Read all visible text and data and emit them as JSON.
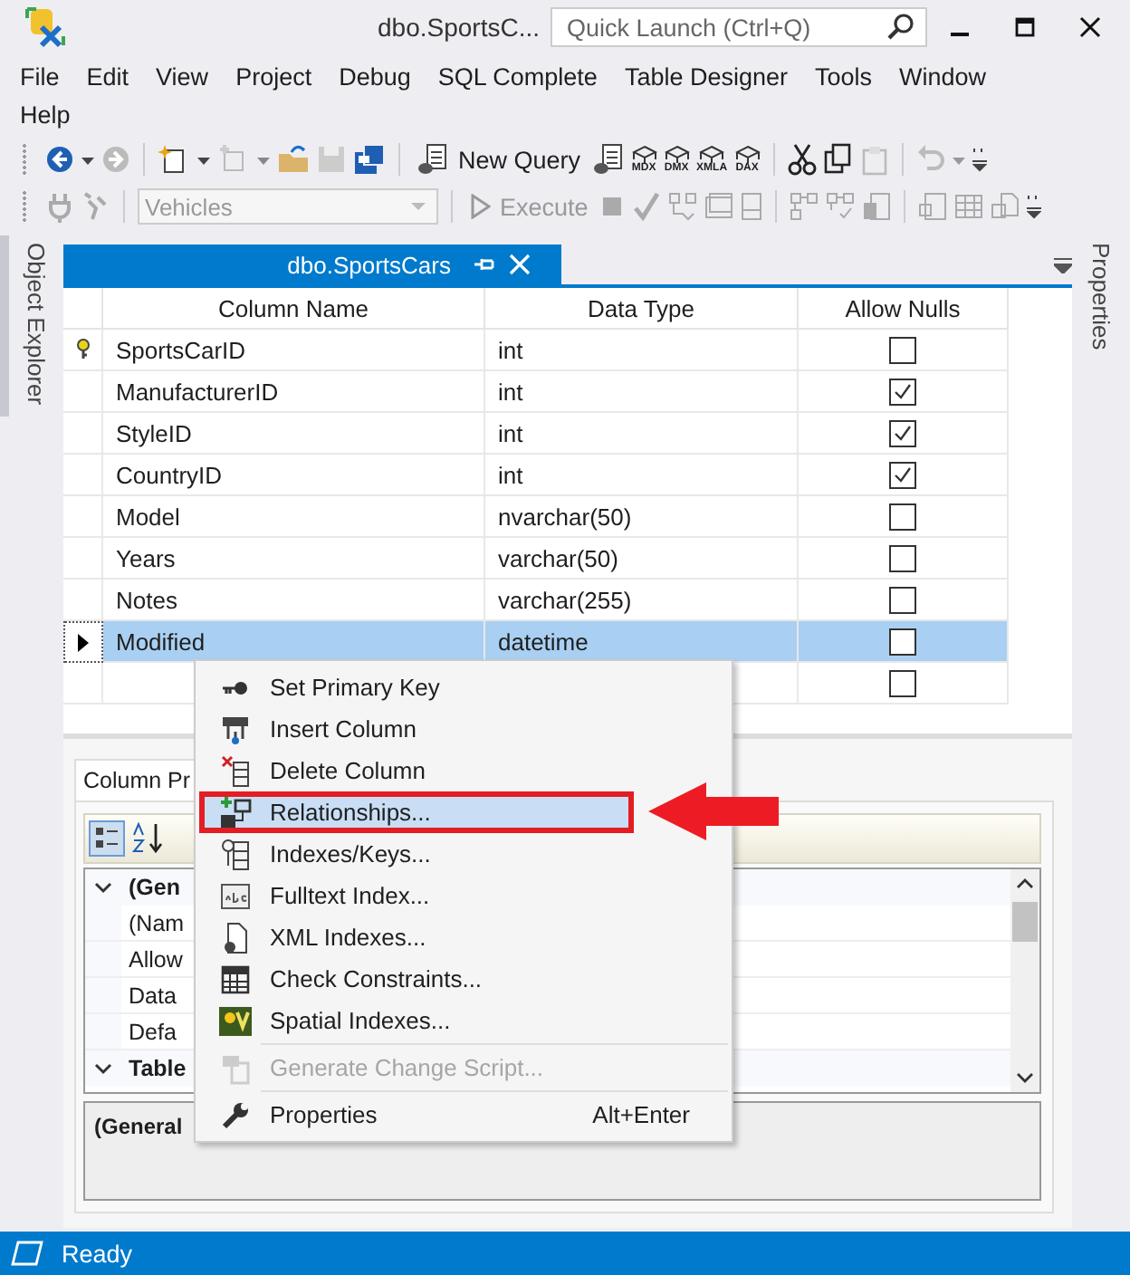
{
  "window": {
    "title": "dbo.SportsC...",
    "quick_launch": {
      "placeholder": "Quick Launch (Ctrl+Q)"
    }
  },
  "menu_bar": [
    "File",
    "Edit",
    "View",
    "Project",
    "Debug",
    "SQL Complete",
    "Table Designer",
    "Tools",
    "Window",
    "Help"
  ],
  "toolbar": {
    "new_query": "New Query",
    "icon_labels": [
      "MDX",
      "DMX",
      "XMLA",
      "DAX"
    ],
    "database": {
      "value": "Vehicles",
      "disabled": true
    },
    "execute": {
      "label": "Execute",
      "disabled": true
    }
  },
  "side_tabs": {
    "left": "Object Explorer",
    "right": "Properties"
  },
  "document_tab": {
    "title": "dbo.SportsCars",
    "selected": true
  },
  "table": {
    "columns": [
      "Column Name",
      "Data Type",
      "Allow Nulls"
    ],
    "rows": [
      {
        "kind": "column",
        "name": "SportsCarID",
        "type": "int",
        "allow_nulls": false,
        "primary_key": true,
        "selected": false
      },
      {
        "kind": "column",
        "name": "ManufacturerID",
        "type": "int",
        "allow_nulls": true,
        "primary_key": false,
        "selected": false
      },
      {
        "kind": "column",
        "name": "StyleID",
        "type": "int",
        "allow_nulls": true,
        "primary_key": false,
        "selected": false
      },
      {
        "kind": "column",
        "name": "CountryID",
        "type": "int",
        "allow_nulls": true,
        "primary_key": false,
        "selected": false
      },
      {
        "kind": "column",
        "name": "Model",
        "type": "nvarchar(50)",
        "allow_nulls": false,
        "primary_key": false,
        "selected": false
      },
      {
        "kind": "column",
        "name": "Years",
        "type": "varchar(50)",
        "allow_nulls": false,
        "primary_key": false,
        "selected": false
      },
      {
        "kind": "column",
        "name": "Notes",
        "type": "varchar(255)",
        "allow_nulls": false,
        "primary_key": false,
        "selected": false
      },
      {
        "kind": "column",
        "name": "Modified",
        "type": "datetime",
        "allow_nulls": false,
        "primary_key": false,
        "selected": true
      },
      {
        "kind": "new",
        "allow_nulls": false,
        "primary_key": false,
        "selected": false
      }
    ]
  },
  "column_properties": {
    "tab": "Column Pr",
    "groups": [
      {
        "name": "(Gen",
        "expanded": true,
        "items": [
          "(Nam",
          "Allow",
          "Data",
          "Defa"
        ]
      },
      {
        "name": "Table",
        "expanded": true
      }
    ],
    "description": "(General"
  },
  "context_menu": [
    {
      "kind": "item",
      "label": "Set Primary Key",
      "disabled": false,
      "selected": false,
      "highlighted": false
    },
    {
      "kind": "item",
      "label": "Insert Column",
      "disabled": false,
      "selected": false,
      "highlighted": false
    },
    {
      "kind": "item",
      "label": "Delete Column",
      "disabled": false,
      "selected": false,
      "highlighted": false
    },
    {
      "kind": "item",
      "label": "Relationships...",
      "disabled": false,
      "selected": true,
      "highlighted": true
    },
    {
      "kind": "item",
      "label": "Indexes/Keys...",
      "disabled": false,
      "selected": false,
      "highlighted": false
    },
    {
      "kind": "item",
      "label": "Fulltext Index...",
      "disabled": false,
      "selected": false,
      "highlighted": false
    },
    {
      "kind": "item",
      "label": "XML Indexes...",
      "disabled": false,
      "selected": false,
      "highlighted": false
    },
    {
      "kind": "item",
      "label": "Check Constraints...",
      "disabled": false,
      "selected": false,
      "highlighted": false
    },
    {
      "kind": "item",
      "label": "Spatial Indexes...",
      "disabled": false,
      "selected": false,
      "highlighted": false
    },
    {
      "kind": "separator"
    },
    {
      "kind": "item",
      "label": "Generate Change Script...",
      "disabled": true,
      "selected": false,
      "highlighted": false
    },
    {
      "kind": "separator"
    },
    {
      "kind": "item",
      "label": "Properties",
      "shortcut": "Alt+Enter",
      "disabled": false,
      "selected": false,
      "highlighted": false
    }
  ],
  "status_bar": {
    "text": "Ready"
  }
}
